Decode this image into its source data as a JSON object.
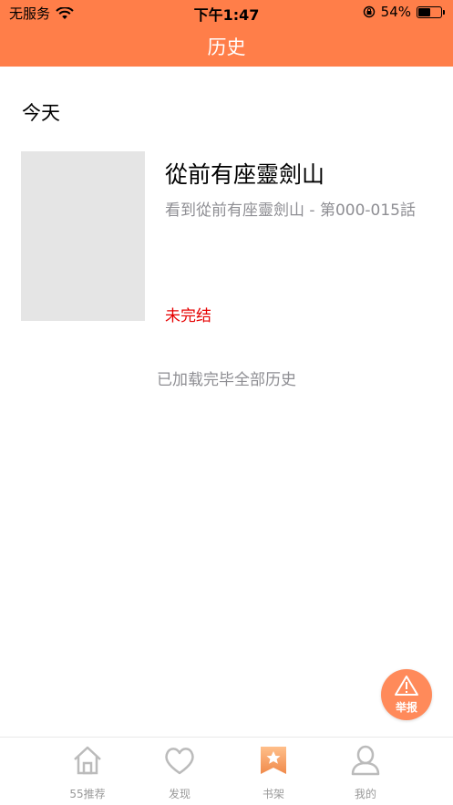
{
  "status_bar": {
    "carrier": "无服务",
    "time": "下午1:47",
    "battery": "54%"
  },
  "nav": {
    "title": "历史"
  },
  "section": {
    "title": "今天"
  },
  "history_items": [
    {
      "title": "從前有座靈劍山",
      "subtitle": "看到從前有座靈劍山 - 第000-015話",
      "status": "未完结"
    }
  ],
  "footer_text": "已加载完毕全部历史",
  "report_button": {
    "label": "举报"
  },
  "tabs": [
    {
      "label": "55推荐",
      "icon": "home-icon"
    },
    {
      "label": "发现",
      "icon": "heart-icon"
    },
    {
      "label": "书架",
      "icon": "bookshelf-icon",
      "active": true
    },
    {
      "label": "我的",
      "icon": "profile-icon"
    }
  ],
  "colors": {
    "header": "#ff7e49",
    "status_red": "#e60000",
    "report_button": "#ff8a5a"
  }
}
